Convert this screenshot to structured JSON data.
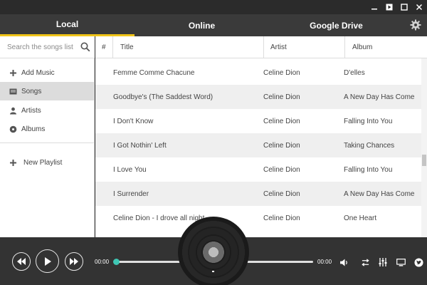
{
  "tabs": [
    {
      "label": "Local",
      "active": true
    },
    {
      "label": "Online",
      "active": false
    },
    {
      "label": "Google Drive",
      "active": false
    }
  ],
  "search": {
    "placeholder": "Search the songs list"
  },
  "sidebar": {
    "items": [
      {
        "label": "Add Music",
        "icon": "plus-icon"
      },
      {
        "label": "Songs",
        "icon": "songs-icon",
        "selected": true
      },
      {
        "label": "Artists",
        "icon": "artist-icon"
      },
      {
        "label": "Albums",
        "icon": "album-icon"
      },
      {
        "label": "New Playlist",
        "icon": "plus-icon"
      }
    ]
  },
  "table": {
    "columns": [
      "#",
      "Title",
      "Artist",
      "Album"
    ],
    "rows": [
      {
        "title": "Femme Comme Chacune",
        "artist": "Celine Dion",
        "album": "D'elles"
      },
      {
        "title": "Goodbye's (The Saddest Word)",
        "artist": "Celine Dion",
        "album": "A New Day Has Come"
      },
      {
        "title": "I Don't Know",
        "artist": "Celine Dion",
        "album": "Falling Into You"
      },
      {
        "title": "I Got Nothin' Left",
        "artist": "Celine Dion",
        "album": "Taking Chances"
      },
      {
        "title": "I Love You",
        "artist": "Celine Dion",
        "album": "Falling Into You"
      },
      {
        "title": "I Surrender",
        "artist": "Celine Dion",
        "album": "A New Day Has Come"
      },
      {
        "title": "Celine Dion - I drove all night",
        "artist": "Celine Dion",
        "album": "One Heart"
      }
    ]
  },
  "player": {
    "time_elapsed": "00:00",
    "time_total": "00:00",
    "progress": 0.0
  },
  "colors": {
    "accent": "#f0c419",
    "progress": "#3fc7b4",
    "chrome": "#3a3a3a",
    "player_bg": "#333333"
  }
}
